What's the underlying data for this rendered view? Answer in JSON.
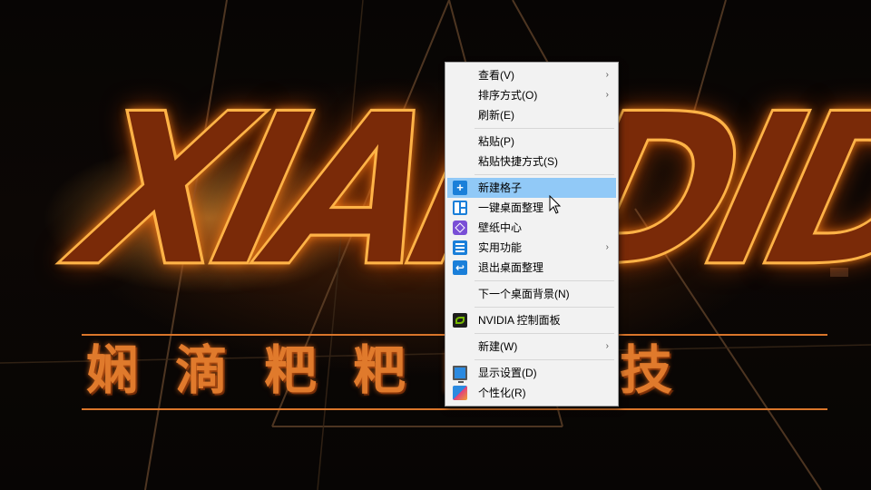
{
  "wallpaper": {
    "logo_text": "XIANDIDABA",
    "subtitle_text": "娴滴粑粑的科技"
  },
  "context_menu": {
    "items": [
      {
        "label": "查看(V)",
        "submenu": true,
        "icon": ""
      },
      {
        "label": "排序方式(O)",
        "submenu": true,
        "icon": ""
      },
      {
        "label": "刷新(E)",
        "submenu": false,
        "icon": ""
      },
      {
        "label": "粘贴(P)",
        "submenu": false,
        "icon": ""
      },
      {
        "label": "粘贴快捷方式(S)",
        "submenu": false,
        "icon": ""
      },
      {
        "label": "新建格子",
        "submenu": false,
        "icon": "plus-icon",
        "highlighted": true
      },
      {
        "label": "一键桌面整理",
        "submenu": false,
        "icon": "grid-layout-icon"
      },
      {
        "label": "壁纸中心",
        "submenu": false,
        "icon": "cube-icon"
      },
      {
        "label": "实用功能",
        "submenu": true,
        "icon": "list-icon"
      },
      {
        "label": "退出桌面整理",
        "submenu": false,
        "icon": "exit-icon"
      },
      {
        "label": "下一个桌面背景(N)",
        "submenu": false,
        "icon": ""
      },
      {
        "label": "NVIDIA 控制面板",
        "submenu": false,
        "icon": "nvidia-icon"
      },
      {
        "label": "新建(W)",
        "submenu": true,
        "icon": ""
      },
      {
        "label": "显示设置(D)",
        "submenu": false,
        "icon": "display-icon"
      },
      {
        "label": "个性化(R)",
        "submenu": false,
        "icon": "personalize-icon"
      }
    ],
    "submenu_arrow": "›"
  },
  "colors": {
    "menu_background": "#f2f2f2",
    "menu_highlight": "#91c9f7",
    "accent_blue": "#1a7fd9",
    "logo_glow": "#ff8c1e"
  }
}
